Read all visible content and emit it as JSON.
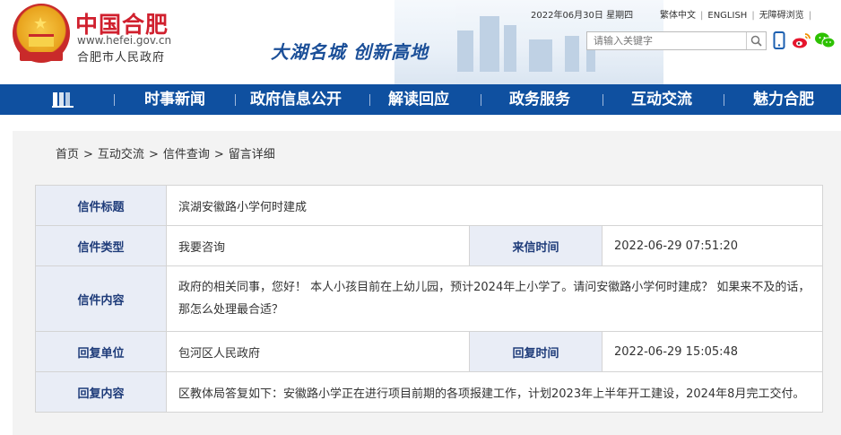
{
  "header": {
    "logo_text": "中国合肥",
    "logo_url": "www.hefei.gov.cn",
    "logo_sub": "合肥市人民政府",
    "slogan": "大湖名城  创新高地",
    "date": "2022年06月30日 星期四",
    "links": [
      "繁体中文",
      "ENGLISH",
      "无障碍浏览"
    ],
    "search_placeholder": "请输入关键字",
    "icons": [
      "search-icon",
      "phone-icon",
      "weibo-icon",
      "wechat-icon"
    ]
  },
  "nav": {
    "home_icon": "home-icon",
    "items": [
      "时事新闻",
      "政府信息公开",
      "解读回应",
      "政务服务",
      "互动交流",
      "魅力合肥"
    ]
  },
  "breadcrumb": [
    "首页",
    "互动交流",
    "信件查询",
    "留言详细"
  ],
  "letter": {
    "title_label": "信件标题",
    "title": "滨湖安徽路小学何时建成",
    "type_label": "信件类型",
    "type": "我要咨询",
    "time_label": "来信时间",
    "time": "2022-06-29 07:51:20",
    "content_label": "信件内容",
    "content": "政府的相关同事，您好！ 本人小孩目前在上幼儿园，预计2024年上小学了。请问安徽路小学何时建成？ 如果来不及的话，那怎么处理最合适？",
    "reply_unit_label": "回复单位",
    "reply_unit": "包河区人民政府",
    "reply_time_label": "回复时间",
    "reply_time": "2022-06-29 15:05:48",
    "reply_content_label": "回复内容",
    "reply_content": "区教体局答复如下：安徽路小学正在进行项目前期的各项报建工作，计划2023年上半年开工建设，2024年8月完工交付。"
  },
  "colors": {
    "nav_bg": "#0f50a0",
    "brand_red": "#d0202e",
    "label_bg": "#e9edf6",
    "label_text": "#1f3c7a"
  }
}
